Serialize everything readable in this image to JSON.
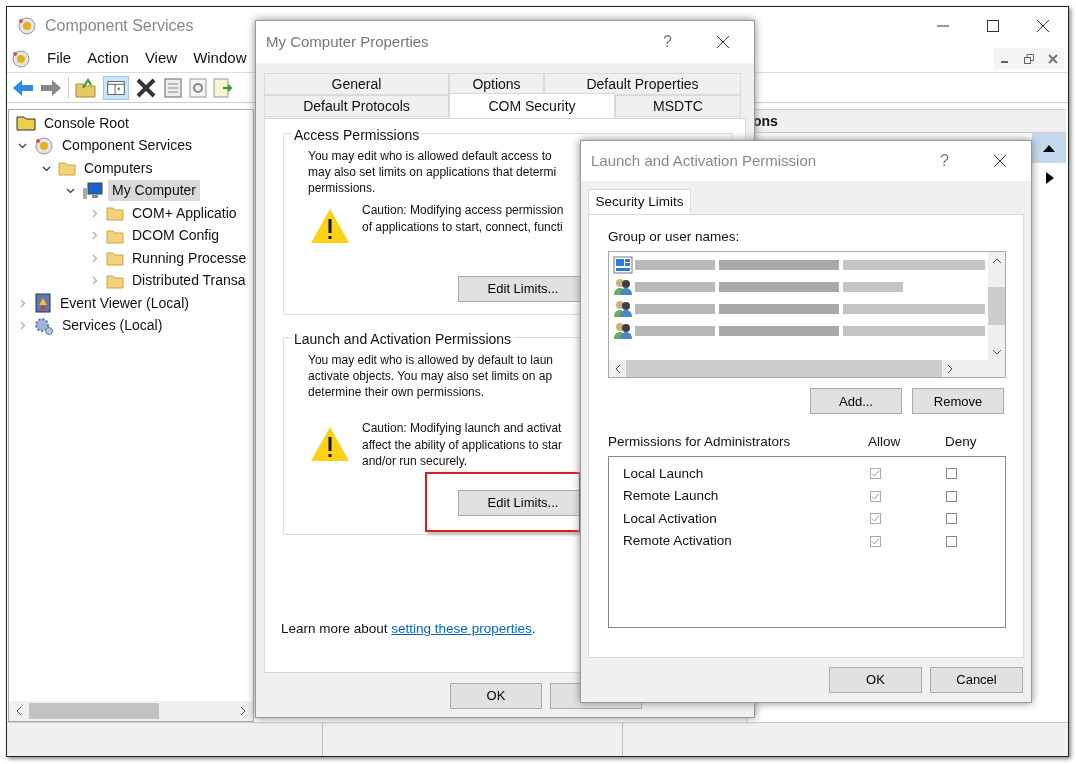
{
  "window": {
    "title": "Component Services"
  },
  "menu": [
    "File",
    "Action",
    "View",
    "Window"
  ],
  "tree": [
    {
      "label": "Console Root",
      "kind": "root",
      "selected": false,
      "children": [
        {
          "label": "Component Services",
          "kind": "services",
          "expanded": true,
          "selected": false,
          "children": [
            {
              "label": "Computers",
              "kind": "folder",
              "expanded": true,
              "selected": false,
              "children": [
                {
                  "label": "My Computer",
                  "kind": "computer",
                  "expanded": true,
                  "selected": true,
                  "children": [
                    {
                      "label": "COM+ Applicatio",
                      "kind": "folder",
                      "expanded": false,
                      "selected": false
                    },
                    {
                      "label": "DCOM Config",
                      "kind": "folder",
                      "expanded": false,
                      "selected": false
                    },
                    {
                      "label": "Running Processe",
                      "kind": "folder",
                      "expanded": false,
                      "selected": false
                    },
                    {
                      "label": "Distributed Transa",
                      "kind": "folder",
                      "expanded": false,
                      "selected": false
                    }
                  ]
                }
              ]
            }
          ]
        },
        {
          "label": "Event Viewer (Local)",
          "kind": "events",
          "expanded": false,
          "selected": false
        },
        {
          "label": "Services (Local)",
          "kind": "gears",
          "expanded": false,
          "selected": false
        }
      ]
    }
  ],
  "actions_pane": {
    "header": "ons"
  },
  "properties_dialog": {
    "title": "My Computer Properties",
    "help": "?",
    "tab_rows": [
      [
        {
          "label": "General",
          "selected": false
        },
        {
          "label": "Options",
          "selected": false
        },
        {
          "label": "Default Properties",
          "selected": false
        }
      ],
      [
        {
          "label": "Default Protocols",
          "selected": false
        },
        {
          "label": "COM Security",
          "selected": true
        },
        {
          "label": "MSDTC",
          "selected": false
        }
      ]
    ],
    "groups": [
      {
        "title": "Access Permissions",
        "text_lines": [
          "You may edit who is allowed default access to",
          "may also set limits on applications that determi",
          "permissions."
        ],
        "caution_lines": [
          "Caution: Modifying access permission",
          "of applications to start, connect, functi"
        ],
        "button": "Edit Limits...",
        "highlighted": false
      },
      {
        "title": "Launch and Activation Permissions",
        "text_lines": [
          "You may edit who is allowed by default to laun",
          "activate objects. You may also set limits on ap",
          "determine their own permissions."
        ],
        "caution_lines": [
          "Caution: Modifying launch and activat",
          "affect the ability of applications to star",
          "and/or run securely."
        ],
        "button": "Edit Limits...",
        "highlighted": true
      }
    ],
    "learn_more": {
      "text": "Learn more about ",
      "link": "setting these properties",
      "after": "."
    },
    "buttons": [
      "OK"
    ]
  },
  "permission_dialog": {
    "title": "Launch and Activation Permission",
    "help": "?",
    "tab": {
      "label": "Security Limits",
      "selected": true
    },
    "names_label": "Group or user names:",
    "names": [
      {
        "kind": "group"
      },
      {
        "kind": "users"
      },
      {
        "kind": "users"
      },
      {
        "kind": "users"
      }
    ],
    "name_buttons": [
      "Add...",
      "Remove"
    ],
    "permissions_label": "Permissions for Administrators",
    "allow_label": "Allow",
    "deny_label": "Deny",
    "permissions": [
      {
        "name": "Local Launch",
        "allow": true,
        "deny": false
      },
      {
        "name": "Remote Launch",
        "allow": true,
        "deny": false
      },
      {
        "name": "Local Activation",
        "allow": true,
        "deny": false
      },
      {
        "name": "Remote Activation",
        "allow": true,
        "deny": false
      }
    ],
    "buttons": [
      "OK",
      "Cancel"
    ]
  }
}
